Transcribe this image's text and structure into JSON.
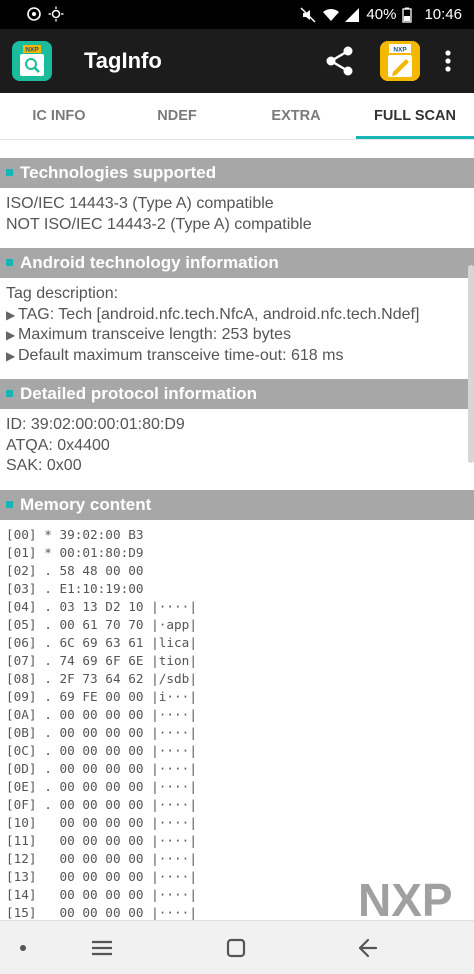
{
  "status_bar": {
    "battery": "40%",
    "time": "10:46"
  },
  "app_bar": {
    "title": "TagInfo",
    "left_logo": "NXP",
    "right_logo": "NXP"
  },
  "tabs": [
    {
      "label": "IC INFO",
      "active": false
    },
    {
      "label": "NDEF",
      "active": false
    },
    {
      "label": "EXTRA",
      "active": false
    },
    {
      "label": "FULL SCAN",
      "active": true
    }
  ],
  "sections": {
    "technologies": {
      "title": "Technologies supported",
      "lines": [
        "ISO/IEC 14443-3 (Type A) compatible",
        "NOT ISO/IEC 14443-2 (Type A) compatible"
      ]
    },
    "android": {
      "title": "Android technology information",
      "lead": "Tag description:",
      "bullets": [
        "TAG: Tech [android.nfc.tech.NfcA, android.nfc.tech.Ndef]",
        "Maximum transceive length: 253 bytes",
        "Default maximum transceive time-out: 618 ms"
      ]
    },
    "protocol": {
      "title": "Detailed protocol information",
      "lines": [
        "ID: 39:02:00:00:01:80:D9",
        "ATQA: 0x4400",
        "SAK: 0x00"
      ]
    },
    "memory": {
      "title": "Memory content",
      "rows": [
        "[00] * 39:02:00 B3",
        "[01] * 00:01:80:D9",
        "[02] . 58 48 00 00",
        "[03] . E1:10:19:00",
        "[04] . 03 13 D2 10 |····|",
        "[05] . 00 61 70 70 |·app|",
        "[06] . 6C 69 63 61 |lica|",
        "[07] . 74 69 6F 6E |tion|",
        "[08] . 2F 73 64 62 |/sdb|",
        "[09] . 69 FE 00 00 |i···|",
        "[0A] . 00 00 00 00 |····|",
        "[0B] . 00 00 00 00 |····|",
        "[0C] . 00 00 00 00 |····|",
        "[0D] . 00 00 00 00 |····|",
        "[0E] . 00 00 00 00 |····|",
        "[0F] . 00 00 00 00 |····|",
        "[10]   00 00 00 00 |····|",
        "[11]   00 00 00 00 |····|",
        "[12]   00 00 00 00 |····|",
        "[13]   00 00 00 00 |····|",
        "[14]   00 00 00 00 |····|",
        "[15]   00 00 00 00 |····|"
      ]
    }
  },
  "watermark": "NXP",
  "nav": {
    "buttons": [
      "recent-apps",
      "home",
      "back"
    ]
  },
  "colors": {
    "accent": "#17b5b5",
    "section_header": "#a7a7a7",
    "app_bar": "#1c1c1c"
  }
}
